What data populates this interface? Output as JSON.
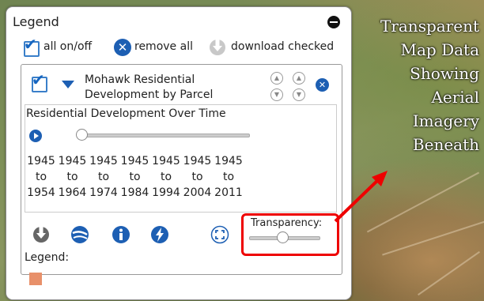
{
  "legend": {
    "title": "Legend",
    "all_toggle": "all on/off",
    "remove_all": "remove all",
    "download_checked": "download checked"
  },
  "layer": {
    "title_line1": "Mohawk Residential",
    "title_line2": "Development by Parcel",
    "subtitle": "Residential Development Over Time",
    "periods": [
      {
        "from": "1945",
        "to_word": "to",
        "to": "1954"
      },
      {
        "from": "1945",
        "to_word": "to",
        "to": "1964"
      },
      {
        "from": "1945",
        "to_word": "to",
        "to": "1974"
      },
      {
        "from": "1945",
        "to_word": "to",
        "to": "1984"
      },
      {
        "from": "1945",
        "to_word": "to",
        "to": "1994"
      },
      {
        "from": "1945",
        "to_word": "to",
        "to": "2004"
      },
      {
        "from": "1945",
        "to_word": "to",
        "to": "2011"
      }
    ],
    "transparency_label": "Transparency:",
    "legend_label": "Legend:",
    "swatch_color": "#e8906a"
  },
  "caption": {
    "lines": [
      "Transparent",
      "Map Data",
      "Showing",
      "Aerial",
      "Imagery",
      "Beneath"
    ]
  },
  "colors": {
    "accent": "#1d5fb3",
    "highlight": "#ee0000"
  }
}
